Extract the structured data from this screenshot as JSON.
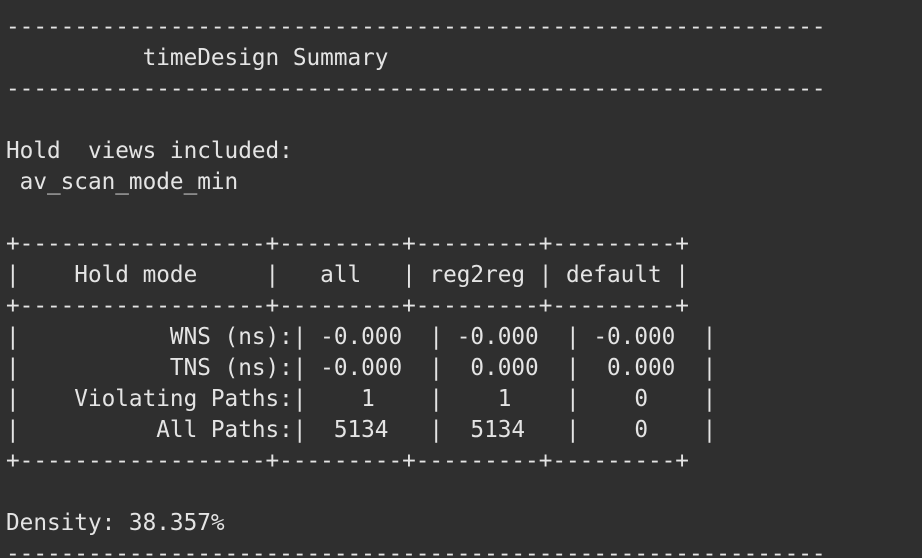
{
  "terminal": {
    "lines": [
      "------------------------------------------------------------",
      "          timeDesign Summary",
      "------------------------------------------------------------",
      "",
      "Hold  views included:",
      " av_scan_mode_min",
      "",
      "+------------------+---------+---------+---------+",
      "|    Hold mode     |   all   | reg2reg | default |",
      "+------------------+---------+---------+---------+",
      "|           WNS (ns):| -0.000  | -0.000  | -0.000  |",
      "|           TNS (ns):| -0.000  |  0.000  |  0.000  |",
      "|    Violating Paths:|    1    |    1    |    0    |",
      "|          All Paths:|  5134   |  5134   |    0    |",
      "+------------------+---------+---------+---------+",
      "",
      "Density: 38.357%",
      "------------------------------------------------------------"
    ]
  }
}
